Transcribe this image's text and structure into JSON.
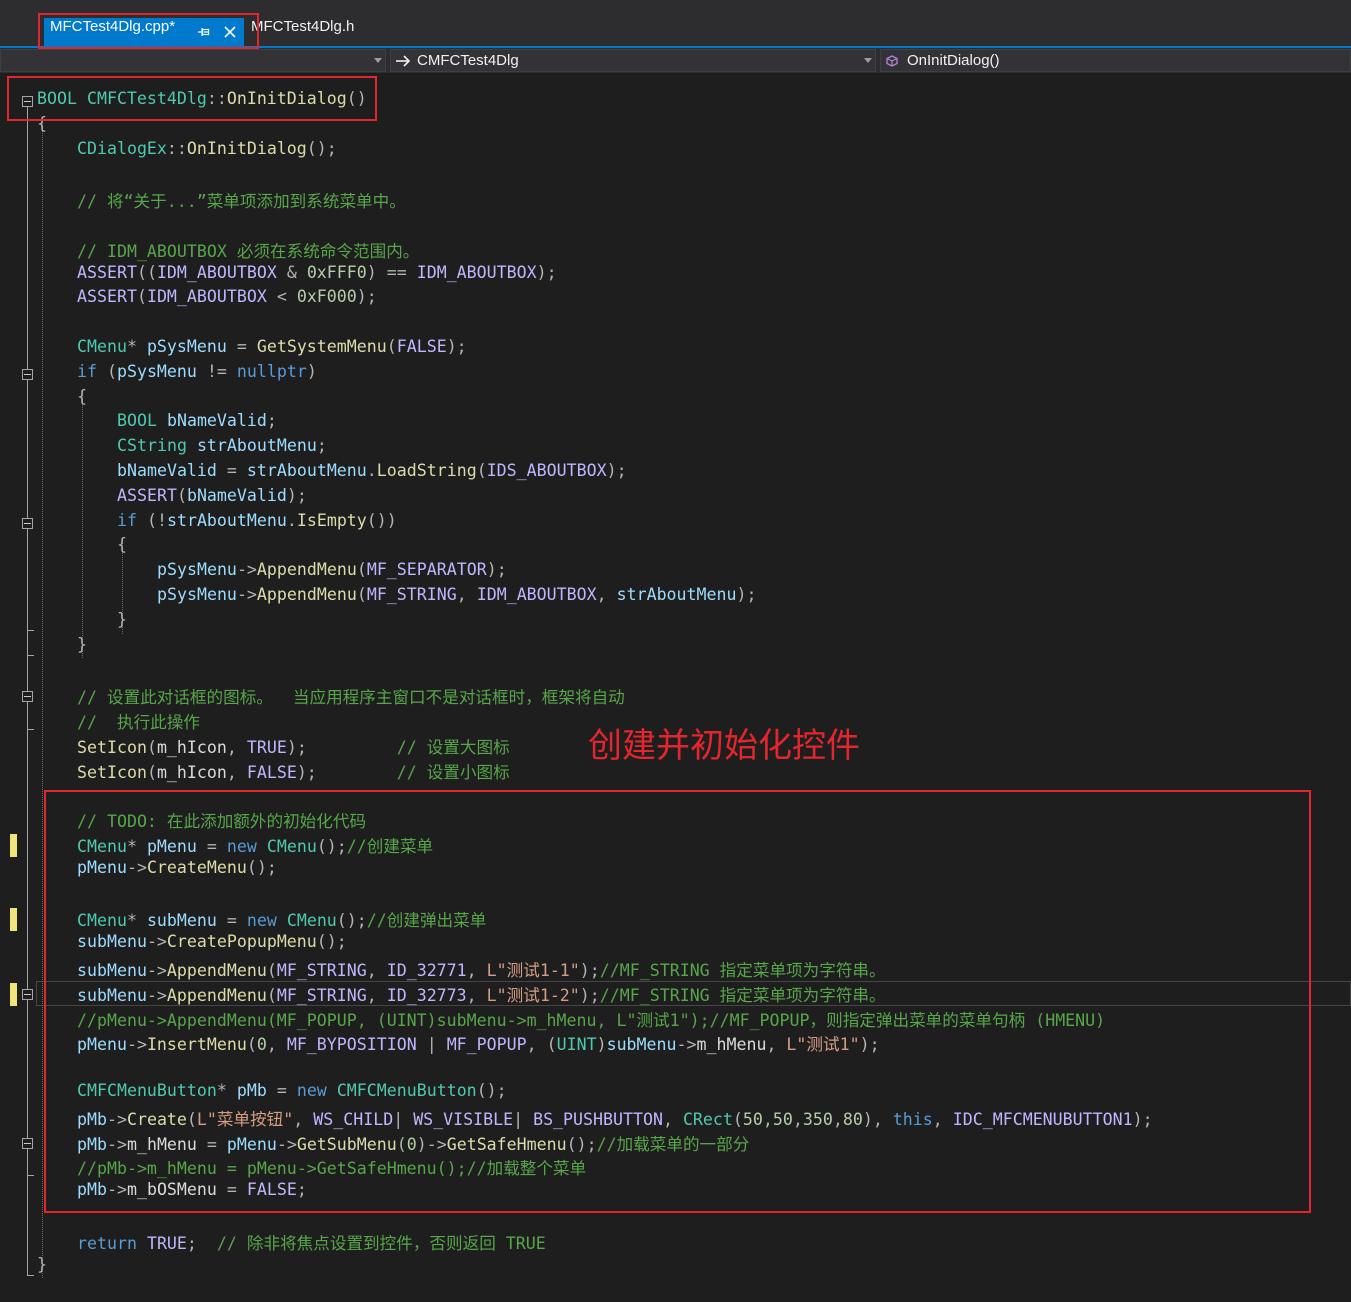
{
  "tabs": [
    {
      "label": "MFCTest4Dlg.cpp*",
      "active": true
    },
    {
      "label": "MFCTest4Dlg.h",
      "active": false
    }
  ],
  "nav": {
    "project": "",
    "scope": "CMFCTest4Dlg",
    "member": "OnInitDialog()"
  },
  "annotation": {
    "label": "创建并初始化控件"
  },
  "icons": {
    "tab_pin": "pin-icon",
    "tab_close": "close-icon",
    "dropdown": "chevron-down-icon",
    "scope": "arrow-right-icon",
    "member": "method-icon",
    "fold": "collapse-icon"
  },
  "theme": {
    "accent": "#007acc",
    "annotation": "#e3262d",
    "change_marker": "#eee47a",
    "background": "#1e1e1e"
  },
  "editor": {
    "current_line": 36,
    "modified_lines": [
      30,
      33,
      36
    ],
    "fold_regions": [
      [
        0,
        47
      ],
      [
        11,
        22
      ],
      [
        17,
        21
      ],
      [
        24,
        25
      ],
      [
        36,
        36
      ],
      [
        42,
        43
      ]
    ],
    "lines": [
      {
        "indent": 0,
        "tokens": [
          [
            "ty",
            "BOOL"
          ],
          [
            "tx",
            " "
          ],
          [
            "ty",
            "CMFCTest4Dlg"
          ],
          [
            "pu",
            "::"
          ],
          [
            "fn",
            "OnInitDialog"
          ],
          [
            "pu",
            "()"
          ]
        ]
      },
      {
        "indent": 0,
        "tokens": [
          [
            "pu",
            "{"
          ]
        ]
      },
      {
        "indent": 1,
        "tokens": [
          [
            "ty",
            "CDialogEx"
          ],
          [
            "pu",
            "::"
          ],
          [
            "fn",
            "OnInitDialog"
          ],
          [
            "pu",
            "();"
          ]
        ]
      },
      {
        "indent": 0,
        "tokens": []
      },
      {
        "indent": 1,
        "tokens": [
          [
            "cm",
            "// 将“关于...”菜单项添加到系统菜单中。"
          ]
        ]
      },
      {
        "indent": 0,
        "tokens": []
      },
      {
        "indent": 1,
        "tokens": [
          [
            "cm",
            "// IDM_ABOUTBOX 必须在系统命令范围内。"
          ]
        ]
      },
      {
        "indent": 1,
        "tokens": [
          [
            "ma",
            "ASSERT"
          ],
          [
            "pu",
            "(("
          ],
          [
            "ma",
            "IDM_ABOUTBOX"
          ],
          [
            "pu",
            " & "
          ],
          [
            "nu",
            "0xFFF0"
          ],
          [
            "pu",
            ") == "
          ],
          [
            "ma",
            "IDM_ABOUTBOX"
          ],
          [
            "pu",
            ");"
          ]
        ]
      },
      {
        "indent": 1,
        "tokens": [
          [
            "ma",
            "ASSERT"
          ],
          [
            "pu",
            "("
          ],
          [
            "ma",
            "IDM_ABOUTBOX"
          ],
          [
            "pu",
            " < "
          ],
          [
            "nu",
            "0xF000"
          ],
          [
            "pu",
            ");"
          ]
        ]
      },
      {
        "indent": 0,
        "tokens": []
      },
      {
        "indent": 1,
        "tokens": [
          [
            "ty",
            "CMenu"
          ],
          [
            "pu",
            "* "
          ],
          [
            "va",
            "pSysMenu"
          ],
          [
            "pu",
            " = "
          ],
          [
            "fn",
            "GetSystemMenu"
          ],
          [
            "pu",
            "("
          ],
          [
            "ma",
            "FALSE"
          ],
          [
            "pu",
            ");"
          ]
        ]
      },
      {
        "indent": 1,
        "tokens": [
          [
            "kw",
            "if"
          ],
          [
            "pu",
            " ("
          ],
          [
            "va",
            "pSysMenu"
          ],
          [
            "pu",
            " != "
          ],
          [
            "kw",
            "nullptr"
          ],
          [
            "pu",
            ")"
          ]
        ]
      },
      {
        "indent": 1,
        "tokens": [
          [
            "pu",
            "{"
          ]
        ]
      },
      {
        "indent": 2,
        "tokens": [
          [
            "ty",
            "BOOL"
          ],
          [
            "tx",
            " "
          ],
          [
            "va",
            "bNameValid"
          ],
          [
            "pu",
            ";"
          ]
        ]
      },
      {
        "indent": 2,
        "tokens": [
          [
            "ty",
            "CString"
          ],
          [
            "tx",
            " "
          ],
          [
            "va",
            "strAboutMenu"
          ],
          [
            "pu",
            ";"
          ]
        ]
      },
      {
        "indent": 2,
        "tokens": [
          [
            "va",
            "bNameValid"
          ],
          [
            "pu",
            " = "
          ],
          [
            "va",
            "strAboutMenu"
          ],
          [
            "pu",
            "."
          ],
          [
            "fn",
            "LoadString"
          ],
          [
            "pu",
            "("
          ],
          [
            "ma",
            "IDS_ABOUTBOX"
          ],
          [
            "pu",
            ");"
          ]
        ]
      },
      {
        "indent": 2,
        "tokens": [
          [
            "ma",
            "ASSERT"
          ],
          [
            "pu",
            "("
          ],
          [
            "va",
            "bNameValid"
          ],
          [
            "pu",
            ");"
          ]
        ]
      },
      {
        "indent": 2,
        "tokens": [
          [
            "kw",
            "if"
          ],
          [
            "pu",
            " (!"
          ],
          [
            "va",
            "strAboutMenu"
          ],
          [
            "pu",
            "."
          ],
          [
            "fn",
            "IsEmpty"
          ],
          [
            "pu",
            "())"
          ]
        ]
      },
      {
        "indent": 2,
        "tokens": [
          [
            "pu",
            "{"
          ]
        ]
      },
      {
        "indent": 3,
        "tokens": [
          [
            "va",
            "pSysMenu"
          ],
          [
            "pu",
            "->"
          ],
          [
            "fn",
            "AppendMenu"
          ],
          [
            "pu",
            "("
          ],
          [
            "ma",
            "MF_SEPARATOR"
          ],
          [
            "pu",
            ");"
          ]
        ]
      },
      {
        "indent": 3,
        "tokens": [
          [
            "va",
            "pSysMenu"
          ],
          [
            "pu",
            "->"
          ],
          [
            "fn",
            "AppendMenu"
          ],
          [
            "pu",
            "("
          ],
          [
            "ma",
            "MF_STRING"
          ],
          [
            "pu",
            ", "
          ],
          [
            "ma",
            "IDM_ABOUTBOX"
          ],
          [
            "pu",
            ", "
          ],
          [
            "va",
            "strAboutMenu"
          ],
          [
            "pu",
            ");"
          ]
        ]
      },
      {
        "indent": 2,
        "tokens": [
          [
            "pu",
            "}"
          ]
        ]
      },
      {
        "indent": 1,
        "tokens": [
          [
            "pu",
            "}"
          ]
        ]
      },
      {
        "indent": 0,
        "tokens": []
      },
      {
        "indent": 1,
        "tokens": [
          [
            "cm",
            "// 设置此对话框的图标。  当应用程序主窗口不是对话框时，框架将自动"
          ]
        ]
      },
      {
        "indent": 1,
        "tokens": [
          [
            "cm",
            "//  执行此操作"
          ]
        ]
      },
      {
        "indent": 1,
        "tokens": [
          [
            "fn",
            "SetIcon"
          ],
          [
            "pu",
            "("
          ],
          [
            "me",
            "m_hIcon"
          ],
          [
            "pu",
            ", "
          ],
          [
            "ma",
            "TRUE"
          ],
          [
            "pu",
            ");"
          ],
          [
            "tx",
            "         "
          ],
          [
            "cm",
            "// 设置大图标"
          ]
        ]
      },
      {
        "indent": 1,
        "tokens": [
          [
            "fn",
            "SetIcon"
          ],
          [
            "pu",
            "("
          ],
          [
            "me",
            "m_hIcon"
          ],
          [
            "pu",
            ", "
          ],
          [
            "ma",
            "FALSE"
          ],
          [
            "pu",
            ");"
          ],
          [
            "tx",
            "        "
          ],
          [
            "cm",
            "// 设置小图标"
          ]
        ]
      },
      {
        "indent": 0,
        "tokens": []
      },
      {
        "indent": 1,
        "tokens": [
          [
            "cm",
            "// TODO: 在此添加额外的初始化代码"
          ]
        ]
      },
      {
        "indent": 1,
        "tokens": [
          [
            "ty",
            "CMenu"
          ],
          [
            "pu",
            "* "
          ],
          [
            "va",
            "pMenu"
          ],
          [
            "pu",
            " = "
          ],
          [
            "kw",
            "new"
          ],
          [
            "tx",
            " "
          ],
          [
            "ty",
            "CMenu"
          ],
          [
            "pu",
            "();"
          ],
          [
            "cm",
            "//创建菜单"
          ]
        ]
      },
      {
        "indent": 1,
        "tokens": [
          [
            "va",
            "pMenu"
          ],
          [
            "pu",
            "->"
          ],
          [
            "fn",
            "CreateMenu"
          ],
          [
            "pu",
            "();"
          ]
        ]
      },
      {
        "indent": 0,
        "tokens": []
      },
      {
        "indent": 1,
        "tokens": [
          [
            "ty",
            "CMenu"
          ],
          [
            "pu",
            "* "
          ],
          [
            "va",
            "subMenu"
          ],
          [
            "pu",
            " = "
          ],
          [
            "kw",
            "new"
          ],
          [
            "tx",
            " "
          ],
          [
            "ty",
            "CMenu"
          ],
          [
            "pu",
            "();"
          ],
          [
            "cm",
            "//创建弹出菜单"
          ]
        ]
      },
      {
        "indent": 1,
        "tokens": [
          [
            "va",
            "subMenu"
          ],
          [
            "pu",
            "->"
          ],
          [
            "fn",
            "CreatePopupMenu"
          ],
          [
            "pu",
            "();"
          ]
        ]
      },
      {
        "indent": 1,
        "tokens": [
          [
            "va",
            "subMenu"
          ],
          [
            "pu",
            "->"
          ],
          [
            "fn",
            "AppendMenu"
          ],
          [
            "pu",
            "("
          ],
          [
            "ma",
            "MF_STRING"
          ],
          [
            "pu",
            ", "
          ],
          [
            "ma",
            "ID_32771"
          ],
          [
            "pu",
            ", "
          ],
          [
            "st",
            "L\"测试1-1\""
          ],
          [
            "pu",
            ");"
          ],
          [
            "cm",
            "//MF_STRING 指定菜单项为字符串。"
          ]
        ]
      },
      {
        "indent": 1,
        "tokens": [
          [
            "va",
            "subMenu"
          ],
          [
            "pu",
            "->"
          ],
          [
            "fn",
            "AppendMenu"
          ],
          [
            "pu",
            "("
          ],
          [
            "ma",
            "MF_STRING"
          ],
          [
            "pu",
            ", "
          ],
          [
            "ma",
            "ID_32773"
          ],
          [
            "pu",
            ", "
          ],
          [
            "st",
            "L\"测试1-2\""
          ],
          [
            "pu",
            ");"
          ],
          [
            "cm",
            "//MF_STRING 指定菜单项为字符串。"
          ]
        ]
      },
      {
        "indent": 1,
        "tokens": [
          [
            "cm",
            "//pMenu->AppendMenu(MF_POPUP, (UINT)subMenu->m_hMenu, L\"测试1\");//MF_POPUP，则指定弹出菜单的菜单句柄 (HMENU)"
          ]
        ]
      },
      {
        "indent": 1,
        "tokens": [
          [
            "va",
            "pMenu"
          ],
          [
            "pu",
            "->"
          ],
          [
            "fn",
            "InsertMenu"
          ],
          [
            "pu",
            "("
          ],
          [
            "nu",
            "0"
          ],
          [
            "pu",
            ", "
          ],
          [
            "ma",
            "MF_BYPOSITION"
          ],
          [
            "pu",
            " | "
          ],
          [
            "ma",
            "MF_POPUP"
          ],
          [
            "pu",
            ", ("
          ],
          [
            "ty",
            "UINT"
          ],
          [
            "pu",
            ")"
          ],
          [
            "va",
            "subMenu"
          ],
          [
            "pu",
            "->"
          ],
          [
            "me",
            "m_hMenu"
          ],
          [
            "pu",
            ", "
          ],
          [
            "st",
            "L\"测试1\""
          ],
          [
            "pu",
            ");"
          ]
        ]
      },
      {
        "indent": 0,
        "tokens": []
      },
      {
        "indent": 1,
        "tokens": [
          [
            "ty",
            "CMFCMenuButton"
          ],
          [
            "pu",
            "* "
          ],
          [
            "va",
            "pMb"
          ],
          [
            "pu",
            " = "
          ],
          [
            "kw",
            "new"
          ],
          [
            "tx",
            " "
          ],
          [
            "ty",
            "CMFCMenuButton"
          ],
          [
            "pu",
            "();"
          ]
        ]
      },
      {
        "indent": 1,
        "tokens": [
          [
            "va",
            "pMb"
          ],
          [
            "pu",
            "->"
          ],
          [
            "fn",
            "Create"
          ],
          [
            "pu",
            "("
          ],
          [
            "st",
            "L\"菜单按钮\""
          ],
          [
            "pu",
            ", "
          ],
          [
            "ma",
            "WS_CHILD"
          ],
          [
            "pu",
            "| "
          ],
          [
            "ma",
            "WS_VISIBLE"
          ],
          [
            "pu",
            "| "
          ],
          [
            "ma",
            "BS_PUSHBUTTON"
          ],
          [
            "pu",
            ", "
          ],
          [
            "ty",
            "CRect"
          ],
          [
            "pu",
            "("
          ],
          [
            "nu",
            "50"
          ],
          [
            "pu",
            ","
          ],
          [
            "nu",
            "50"
          ],
          [
            "pu",
            ","
          ],
          [
            "nu",
            "350"
          ],
          [
            "pu",
            ","
          ],
          [
            "nu",
            "80"
          ],
          [
            "pu",
            "), "
          ],
          [
            "kw",
            "this"
          ],
          [
            "pu",
            ", "
          ],
          [
            "ma",
            "IDC_MFCMENUBUTTON1"
          ],
          [
            "pu",
            ");"
          ]
        ]
      },
      {
        "indent": 1,
        "tokens": [
          [
            "va",
            "pMb"
          ],
          [
            "pu",
            "->"
          ],
          [
            "me",
            "m_hMenu"
          ],
          [
            "pu",
            " = "
          ],
          [
            "va",
            "pMenu"
          ],
          [
            "pu",
            "->"
          ],
          [
            "fn",
            "GetSubMenu"
          ],
          [
            "pu",
            "("
          ],
          [
            "nu",
            "0"
          ],
          [
            "pu",
            ")->"
          ],
          [
            "fn",
            "GetSafeHmenu"
          ],
          [
            "pu",
            "();"
          ],
          [
            "cm",
            "//加载菜单的一部分"
          ]
        ]
      },
      {
        "indent": 1,
        "tokens": [
          [
            "cm",
            "//pMb->m_hMenu = pMenu->GetSafeHmenu();//加载整个菜单"
          ]
        ]
      },
      {
        "indent": 1,
        "tokens": [
          [
            "va",
            "pMb"
          ],
          [
            "pu",
            "->"
          ],
          [
            "me",
            "m_bOSMenu"
          ],
          [
            "pu",
            " = "
          ],
          [
            "ma",
            "FALSE"
          ],
          [
            "pu",
            ";"
          ]
        ]
      },
      {
        "indent": 0,
        "tokens": []
      },
      {
        "indent": 1,
        "tokens": [
          [
            "kw",
            "return"
          ],
          [
            "tx",
            " "
          ],
          [
            "ma",
            "TRUE"
          ],
          [
            "pu",
            ";"
          ],
          [
            "tx",
            "  "
          ],
          [
            "cm",
            "// 除非将焦点设置到控件，否则返回 TRUE"
          ]
        ]
      },
      {
        "indent": 0,
        "tokens": [
          [
            "pu",
            "}"
          ]
        ]
      }
    ]
  }
}
